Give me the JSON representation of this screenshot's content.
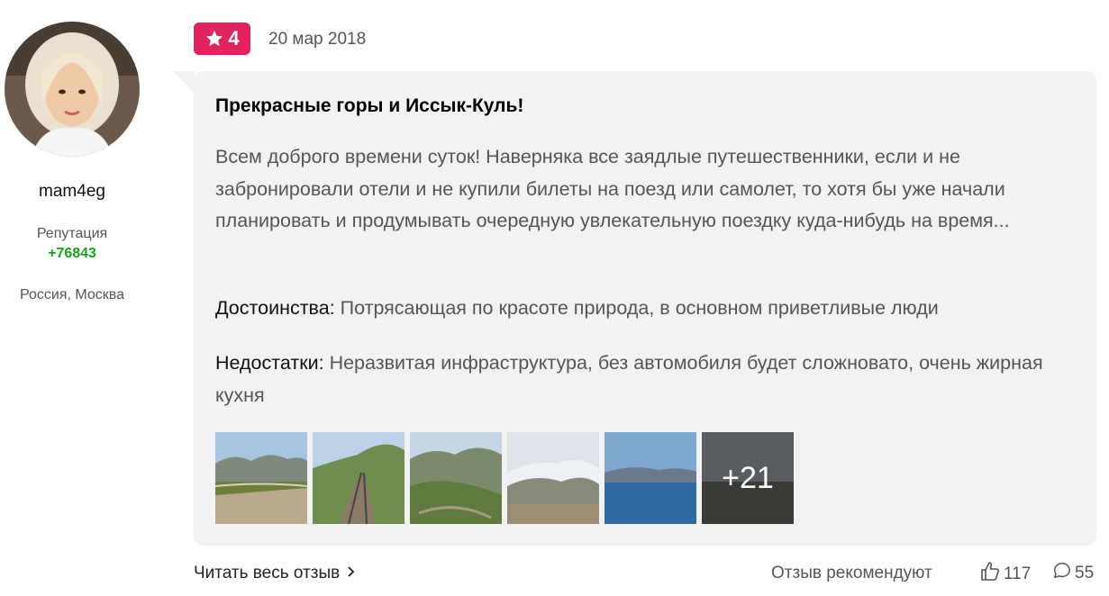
{
  "author": {
    "name": "mam4eg",
    "reputation_label": "Репутация",
    "reputation_value": "+76843",
    "location": "Россия, Москва"
  },
  "review": {
    "rating": "4",
    "date": "20 мар 2018",
    "title": "Прекрасные горы и Иссык-Куль!",
    "text": "Всем доброго времени суток! Наверняка все заядлые путешественники, если и не забронировали отели и не купили билеты на поезд или самолет, то хотя бы уже начали планировать и продумывать очередную увлекательную поездку куда-нибудь на время...",
    "pros_label": "Достоинства:",
    "pros": "Потрясающая по красоте природа, в основном приветливые люди",
    "cons_label": "Недостатки:",
    "cons": "Неразвитая инфраструктура, без автомобиля будет сложновато, очень жирная кухня",
    "more_photos": "+21"
  },
  "footer": {
    "read_more": "Читать весь отзыв",
    "recommend": "Отзыв рекомендуют",
    "likes": "117",
    "comments": "55"
  },
  "colors": {
    "badge": "#e0245e",
    "reputation": "#19a319",
    "bubble": "#f2f2f3"
  },
  "icons": [
    "star-icon",
    "chevron-right-icon",
    "thumbs-up-icon",
    "comment-icon"
  ]
}
